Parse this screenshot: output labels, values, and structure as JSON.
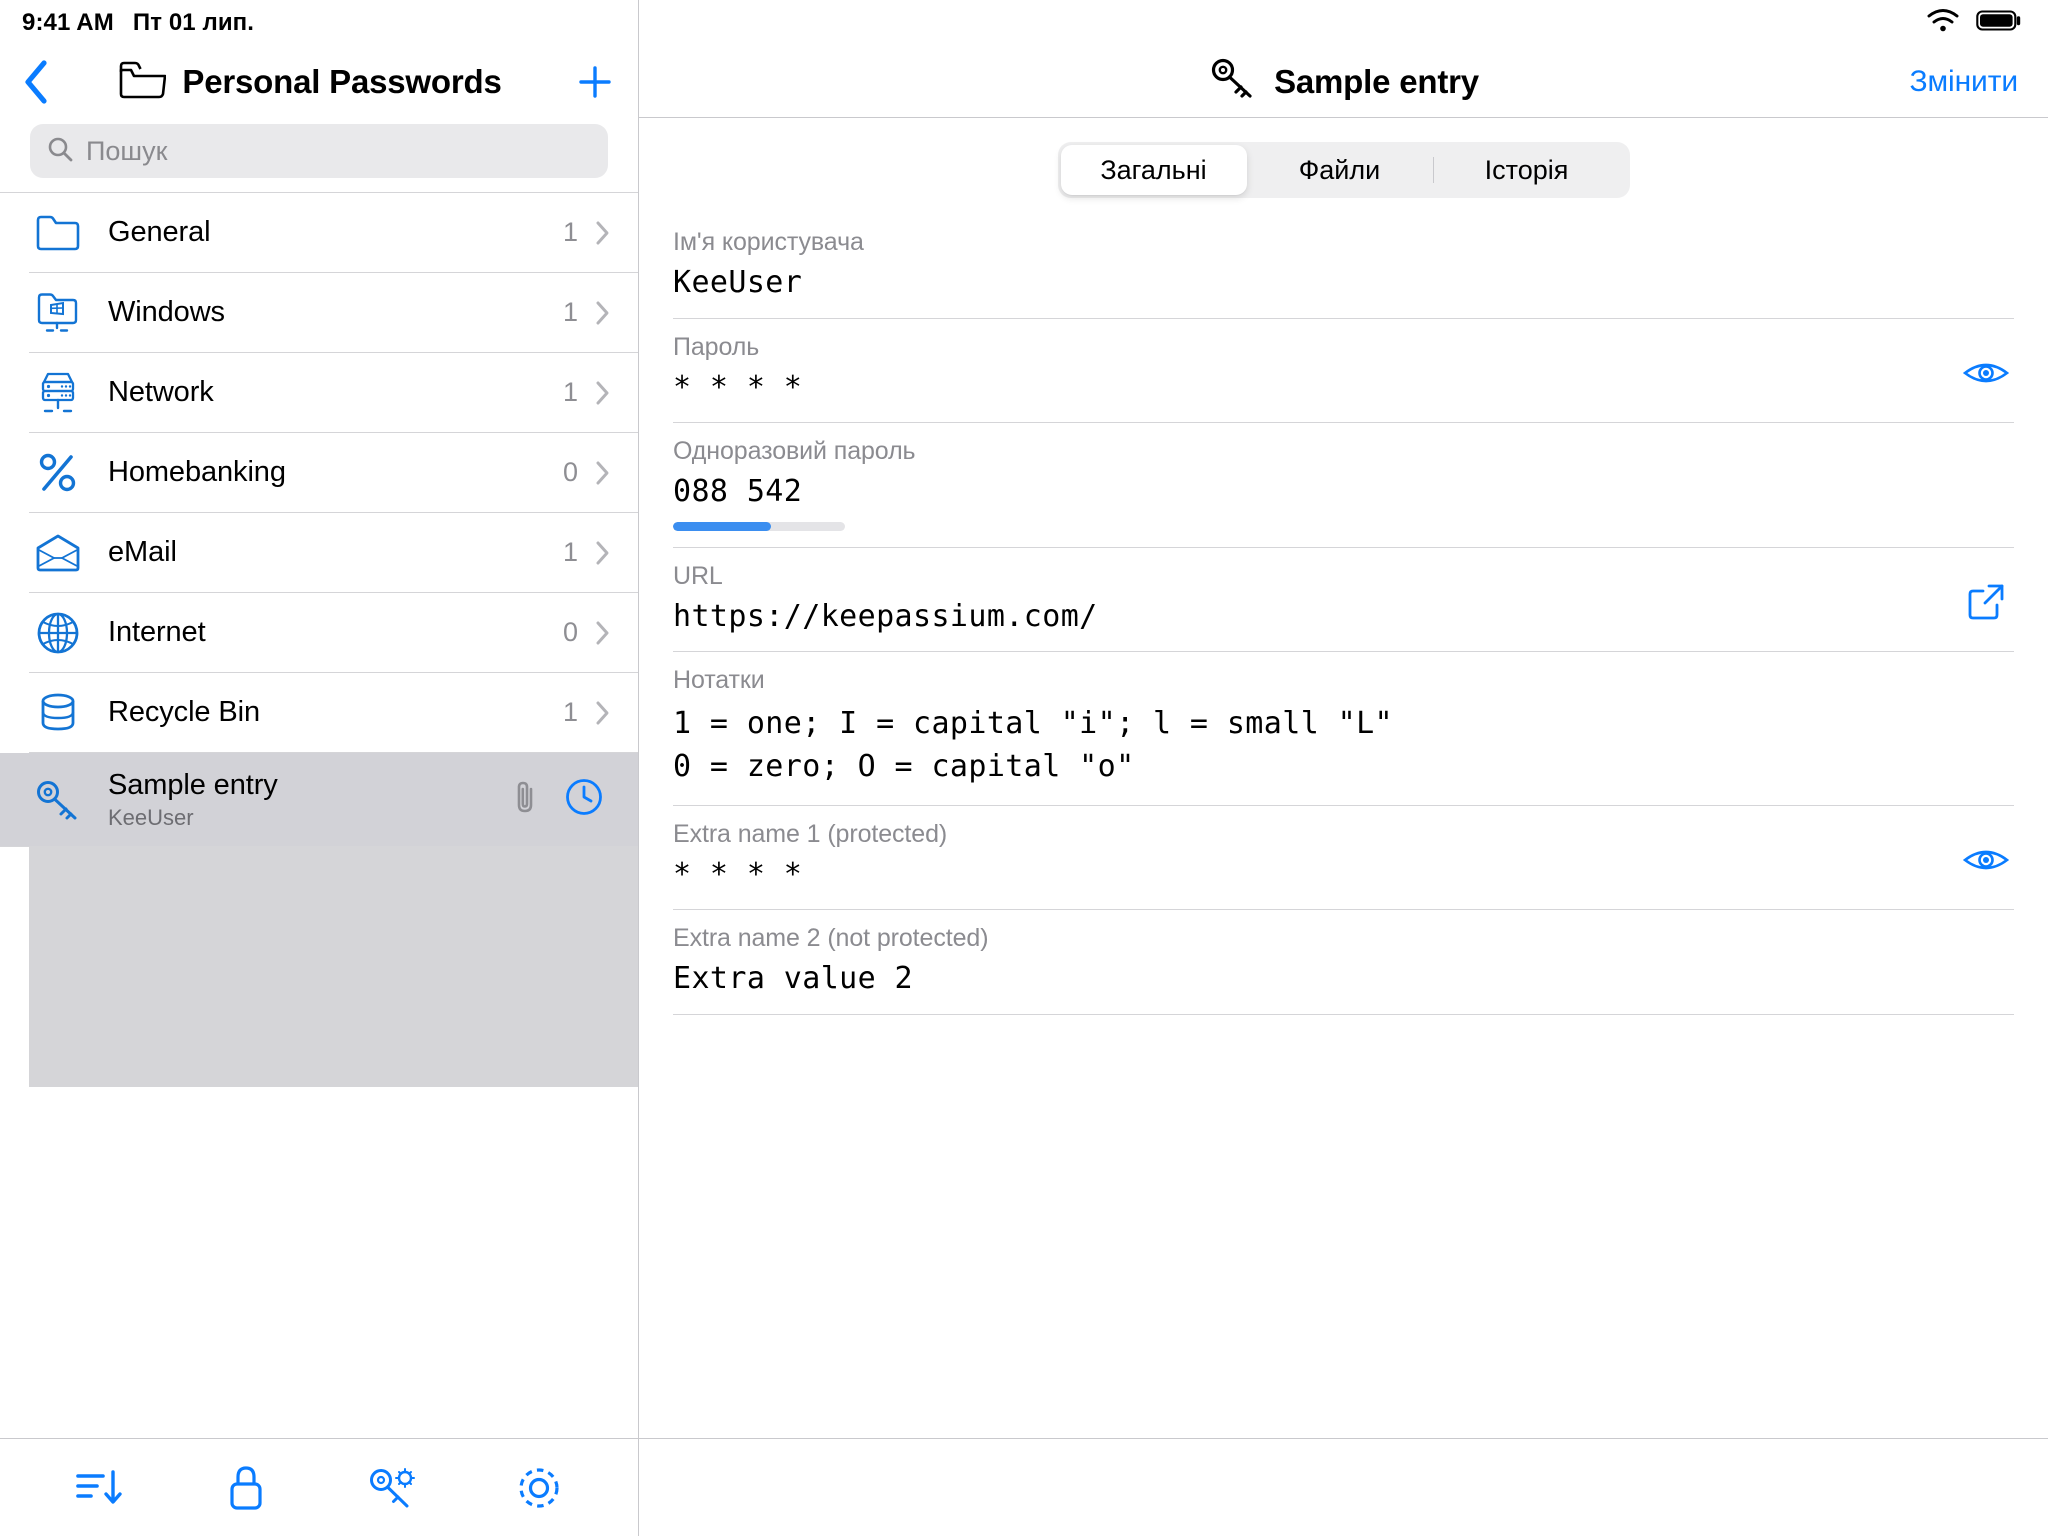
{
  "status_bar": {
    "time": "9:41 AM",
    "date": "Пт 01 лип.",
    "wifi_icon": "wifi-icon",
    "battery_icon": "battery-icon"
  },
  "sidebar": {
    "back_icon": "back-chevron-icon",
    "folder_icon": "folder-icon",
    "title": "Personal Passwords",
    "add_icon": "plus-icon",
    "search": {
      "icon": "search-icon",
      "placeholder": "Пошук",
      "value": ""
    },
    "groups": [
      {
        "label": "General",
        "count": "1",
        "icon": "folder-icon"
      },
      {
        "label": "Windows",
        "count": "1",
        "icon": "windows-folder-icon"
      },
      {
        "label": "Network",
        "count": "1",
        "icon": "server-icon"
      },
      {
        "label": "Homebanking",
        "count": "0",
        "icon": "percent-icon"
      },
      {
        "label": "eMail",
        "count": "1",
        "icon": "envelope-icon"
      },
      {
        "label": "Internet",
        "count": "0",
        "icon": "globe-icon"
      },
      {
        "label": "Recycle Bin",
        "count": "1",
        "icon": "database-icon"
      }
    ],
    "entry": {
      "title": "Sample entry",
      "subtitle": "KeeUser",
      "icon": "key-icon",
      "attachment_icon": "paperclip-icon",
      "history_icon": "clock-icon",
      "selected": true
    },
    "toolbar": [
      {
        "name": "sort-button",
        "icon": "sort-descending-icon"
      },
      {
        "name": "lock-button",
        "icon": "lock-icon"
      },
      {
        "name": "password-generator-button",
        "icon": "key-gear-icon"
      },
      {
        "name": "settings-button",
        "icon": "gear-icon"
      }
    ]
  },
  "detail": {
    "icon": "key-icon",
    "title": "Sample entry",
    "edit_label": "Змінити",
    "tabs": [
      {
        "label": "Загальні",
        "active": true
      },
      {
        "label": "Файли",
        "active": false
      },
      {
        "label": "Історія",
        "active": false
      }
    ],
    "fields": [
      {
        "label": "Ім'я користувача",
        "value": "KeeUser",
        "type": "text",
        "action_icon": null
      },
      {
        "label": "Пароль",
        "value": "* * * *",
        "type": "masked",
        "action_icon": "eye-icon"
      },
      {
        "label": "Одноразовий пароль",
        "value": "088 542",
        "type": "otp",
        "progress_percent": 57,
        "progress_color": "#3b8ef0",
        "action_icon": null
      },
      {
        "label": "URL",
        "value": "https://keepassium.com/",
        "type": "text",
        "action_icon": "open-external-icon"
      },
      {
        "label": "Нотатки",
        "value": "1 = one; I = capital \"i\"; l = small \"L\"\n0 = zero; O = capital \"o\"",
        "type": "multiline",
        "action_icon": null
      },
      {
        "label": "Extra name 1 (protected)",
        "value": "* * * *",
        "type": "masked",
        "action_icon": "eye-icon"
      },
      {
        "label": "Extra name 2 (not protected)",
        "value": "Extra value 2",
        "type": "text",
        "action_icon": null
      }
    ]
  },
  "colors": {
    "accent": "#0a7cff",
    "icon_blue": "#1374d4",
    "selected_row": "#d2d2d7",
    "separator": "#d5d5d8",
    "label_gray": "#8b8b90"
  }
}
